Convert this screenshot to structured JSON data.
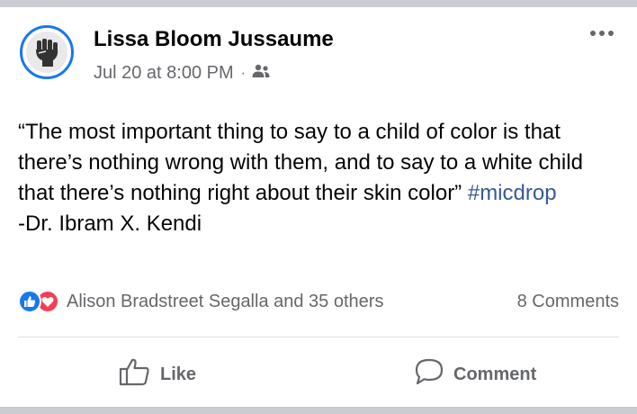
{
  "post": {
    "author": "Lissa Bloom Jussaume",
    "timestamp": "Jul 20 at 8:00 PM",
    "separator": "·",
    "audience_icon": "friends-icon",
    "text_main": "“The most important thing to say to a child of color is that there’s nothing wrong with them, and to say to a white child that there’s nothing right about their skin color” ",
    "hashtag": "#micdrop",
    "attribution": "-Dr. Ibram X. Kendi",
    "avatar_icon": "raised-fist-icon"
  },
  "reactions": {
    "icons": [
      "like-icon",
      "love-icon"
    ],
    "summary": "Alison Bradstreet Segalla and 35 others",
    "comments": "8 Comments"
  },
  "actions": {
    "like_label": "Like",
    "comment_label": "Comment"
  },
  "colors": {
    "accent": "#1877f2",
    "love": "#f33e58",
    "hashtag": "#385898",
    "secondary_text": "#65676b"
  }
}
